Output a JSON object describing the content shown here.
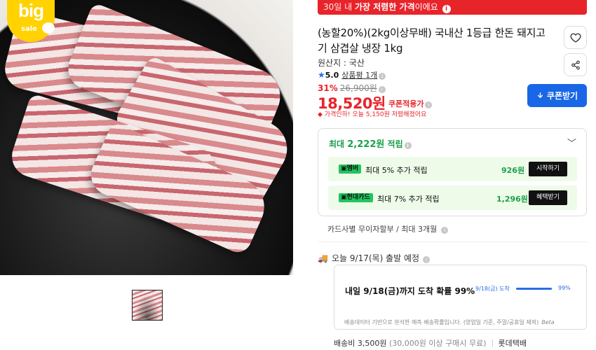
{
  "badge": {
    "text": "big",
    "sub": "sale"
  },
  "banner": {
    "pre": "30일 내 ",
    "bold": "가장 저렴한 가격",
    "post": "이에요",
    "info_icon": "info-icon"
  },
  "product": {
    "title": "(농할20%)(2kg이상무배) 국내산 1등급 한돈 돼지고기 삼겹살 냉장 1kg",
    "origin": "원산지 : 국산",
    "rating": {
      "score": "5.0",
      "review_label": "상품평 1개"
    },
    "discount_pct": "31%",
    "original_price": "26,900원",
    "price": "18,520원",
    "coupon_note": "쿠폰적용가",
    "price_alert": "가격인하! 오늘 5,150원 저렴해졌어요"
  },
  "actions": {
    "coupon_button": "쿠폰받기"
  },
  "reward": {
    "title_pre": "최대 ",
    "title_amount": "2,222원",
    "title_post": " 적립",
    "rows": [
      {
        "pill": "멤버",
        "text": "최대 5% 추가 적립",
        "amount": "926원",
        "button": "시작하기"
      },
      {
        "pill": "현대카드",
        "text": "최대 7% 추가 적립",
        "amount": "1,296원",
        "button": "혜택받기"
      }
    ]
  },
  "installment": "카드사별 무이자할부 / 최대 3개월",
  "shipping": {
    "ship_text": "오늘 9/17(목) 출발 예정",
    "delivery_title": "내일 9/18(금)까지 도착 확률 99%",
    "prob_label": "9/18(금) 도착",
    "prob_value": "99%",
    "prob_fraction": 0.99,
    "footnote": "배송데이터 기반으로 분석한 예측 배송확률입니다. (영업일 기준, 주말/공휴일 제외)",
    "beta": "Beta",
    "fee": "배송비 3,500원",
    "fee_condition": "(30,000원 이상 구매시 무료)",
    "carrier": "롯데택배"
  },
  "colors": {
    "accent_red": "#e8242b",
    "accent_blue": "#1967e6",
    "accent_green": "#1aa04a"
  }
}
